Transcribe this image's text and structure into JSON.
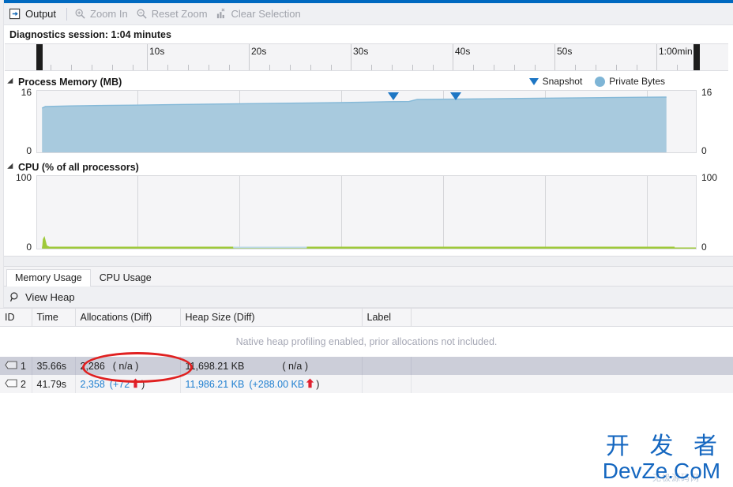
{
  "toolbar": {
    "output_label": "Output",
    "zoom_in_label": "Zoom In",
    "reset_zoom_label": "Reset Zoom",
    "clear_selection_label": "Clear Selection"
  },
  "session": {
    "label": "Diagnostics session: 1:04 minutes"
  },
  "ruler": {
    "ticks": [
      "10s",
      "20s",
      "30s",
      "40s",
      "50s",
      "1:00min"
    ]
  },
  "memory_graph": {
    "title": "Process Memory (MB)",
    "legend": [
      {
        "label": "Snapshot",
        "marker": "triangle-marker",
        "color": "#1d76c4"
      },
      {
        "label": "Private Bytes",
        "marker": "circle-marker",
        "color": "#7eb5d6"
      }
    ],
    "axis_top_left": "16",
    "axis_bottom_left": "0",
    "axis_top_right": "16",
    "axis_bottom_right": "0"
  },
  "cpu_graph": {
    "title": "CPU (% of all processors)",
    "axis_top_left": "100",
    "axis_bottom_left": "0",
    "axis_top_right": "100",
    "axis_bottom_right": "0"
  },
  "tabs": [
    {
      "label": "Memory Usage",
      "active": true
    },
    {
      "label": "CPU Usage",
      "active": false
    }
  ],
  "heap_toolbar": {
    "view_heap_label": "View Heap"
  },
  "table": {
    "headers": [
      "ID",
      "Time",
      "Allocations (Diff)",
      "Heap Size (Diff)",
      "Label",
      ""
    ],
    "note": "Native heap profiling enabled, prior allocations not included.",
    "rows": [
      {
        "id": "1",
        "time": "35.66s",
        "alloc_value": "2,286",
        "alloc_diff": "( n/a )",
        "heap_value": "11,698.21 KB",
        "heap_diff": "( n/a )",
        "label": "",
        "selected": true,
        "alloc_is_link": false,
        "heap_is_link": false,
        "alloc_has_arrow": false,
        "heap_has_arrow": false
      },
      {
        "id": "2",
        "time": "41.79s",
        "alloc_value": "2,358",
        "alloc_diff_open": "(+72",
        "alloc_diff_close": ")",
        "heap_value": "11,986.21 KB",
        "heap_diff_open": "(+288.00 KB",
        "heap_diff_close": ")",
        "label": "",
        "selected": false,
        "alloc_is_link": true,
        "heap_is_link": true,
        "alloc_has_arrow": true,
        "heap_has_arrow": true
      }
    ]
  },
  "annotation": {
    "shape": "red-ellipse",
    "color": "#e02020",
    "targets": "allocations-cell-row-2"
  },
  "watermark": {
    "cn": "开 发 者",
    "en": "DevZe.CoM",
    "sub": "无极源码网"
  },
  "colors": {
    "accent": "#0069c0",
    "memory_fill": "#a8cade",
    "memory_line": "#7eb5d6",
    "cpu_line": "#9ec93a",
    "snapshot_marker": "#1d76c4",
    "link": "#1f7fd0",
    "arrow_up": "#e0202f",
    "selected_row": "#ccced9"
  },
  "chart_data": [
    {
      "type": "area",
      "title": "Process Memory (MB)",
      "ylabel": "MB",
      "ylim": [
        0,
        17
      ],
      "xlim_seconds": [
        0,
        64
      ],
      "grid": true,
      "legend": [
        "Snapshot",
        "Private Bytes"
      ],
      "series": [
        {
          "name": "Private Bytes",
          "x": [
            0,
            1,
            2,
            4,
            8,
            12,
            16,
            20,
            24,
            28,
            32,
            35,
            38,
            41,
            44,
            48,
            52,
            56,
            60,
            62,
            63
          ],
          "values": [
            0,
            13.1,
            13.2,
            13.3,
            13.4,
            13.5,
            13.6,
            13.7,
            13.8,
            13.9,
            14.0,
            14.1,
            14.2,
            14.5,
            14.6,
            14.7,
            14.8,
            14.9,
            15.0,
            15.0,
            0
          ]
        }
      ],
      "markers": [
        {
          "name": "Snapshot 1",
          "x": 35.66
        },
        {
          "name": "Snapshot 2",
          "x": 41.79
        }
      ]
    },
    {
      "type": "line",
      "title": "CPU (% of all processors)",
      "ylabel": "% of all processors",
      "ylim": [
        0,
        100
      ],
      "xlim_seconds": [
        0,
        64
      ],
      "grid": true,
      "series": [
        {
          "name": "CPU",
          "x": [
            0,
            0.5,
            1,
            2,
            5,
            10,
            20,
            30,
            40,
            50,
            60,
            64
          ],
          "values": [
            0,
            9,
            2,
            0.5,
            0.4,
            0.4,
            0.4,
            0.4,
            0.4,
            0.4,
            0.4,
            0.4
          ]
        }
      ]
    }
  ]
}
